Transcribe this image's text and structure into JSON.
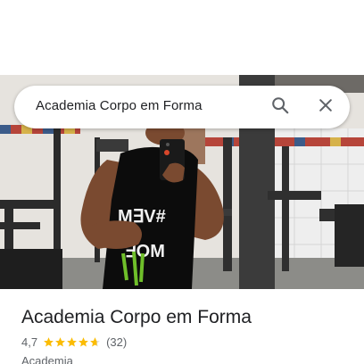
{
  "search": {
    "query": "Academia Corpo em Forma"
  },
  "place": {
    "name": "Academia Corpo em Forma",
    "rating": "4,7",
    "rating_value": 4.7,
    "reviews": "(32)",
    "category": "Academia"
  },
  "photo": {
    "shirt_text_1": "M∃V#",
    "shirt_text_2": "∃OM"
  },
  "colors": {
    "star": "#fbbc04",
    "text": "#202124",
    "muted": "#5f6368",
    "icon": "#5f6368"
  },
  "icons": {
    "search": "search-icon",
    "close": "close-icon",
    "star": "star-icon"
  }
}
